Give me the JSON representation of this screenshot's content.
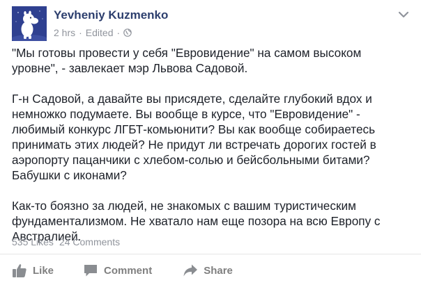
{
  "post": {
    "author": "Yevheniy Kuzmenko",
    "time": "2 hrs",
    "edited": "Edited",
    "paragraphs": [
      "\"Мы готовы провести у себя \"Евровидение\" на самом высоком уровне\", - завлекает мэр Львова Садовой.",
      "Г-н Садовой, а давайте вы присядете, сделайте глубокий вдох и немножко подумаете. Вы вообще в курсе, что \"Евровидение\" - любимый конкурс ЛГБТ-комьюнити? Вы как вообще собираетесь принимать этих людей? Не придут ли встречать дорогих гостей в аэропорту пацанчики с хлебом-солью и бейсбольными битами? Бабушки с иконами?",
      "Как-то боязно за людей, не знакомых с вашим туристическим фундаментализмом. Не хватало нам еще позора на всю Европу с Австралией."
    ],
    "likes": "535 Likes",
    "comments": "24 Comments"
  },
  "actions": {
    "like": "Like",
    "comment": "Comment",
    "share": "Share"
  },
  "icons": {
    "privacy": "globe-icon",
    "menu": "chevron-down-icon",
    "like": "thumbs-up-icon",
    "comment": "speech-bubble-icon",
    "share": "share-arrow-icon"
  }
}
